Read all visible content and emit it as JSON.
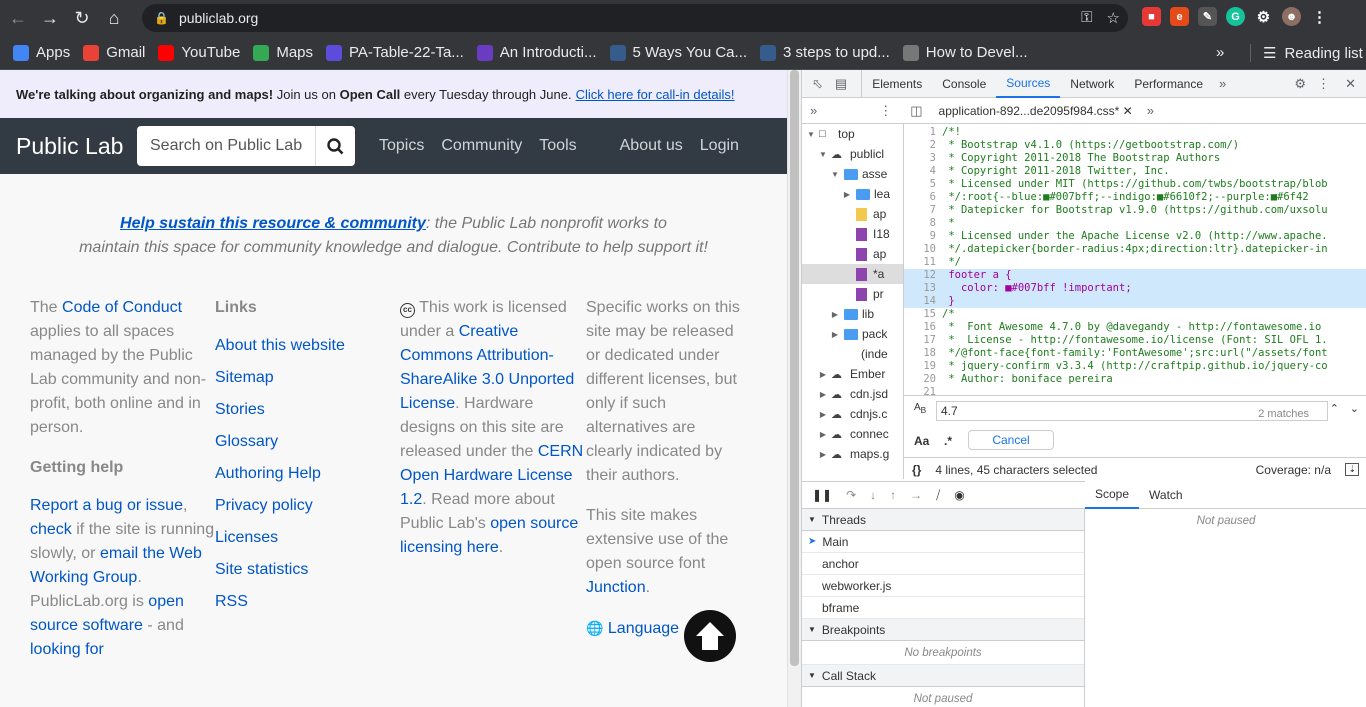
{
  "browser": {
    "url": "publiclab.org",
    "bookmarks": [
      {
        "label": "Apps",
        "icon": "apps-grid-icon",
        "color": "#4285f4"
      },
      {
        "label": "Gmail",
        "icon": "gmail-icon",
        "color": "#ea4335"
      },
      {
        "label": "YouTube",
        "icon": "youtube-icon",
        "color": "#ff0000"
      },
      {
        "label": "Maps",
        "icon": "maps-icon",
        "color": "#34a853"
      },
      {
        "label": "PA-Table-22-Ta...",
        "icon": "stack-icon",
        "color": "#5b4cdb"
      },
      {
        "label": "An Introducti...",
        "icon": "hexagon-icon",
        "color": "#6a3cc2"
      },
      {
        "label": "5 Ways You Ca...",
        "icon": "tds-icon",
        "color": "#355c8b"
      },
      {
        "label": "3 steps to upd...",
        "icon": "tds-icon",
        "color": "#355c8b"
      },
      {
        "label": "How to Devel...",
        "icon": "image-icon",
        "color": "#777777"
      }
    ],
    "reading_list": "Reading list"
  },
  "page": {
    "banner": {
      "bold": "We're talking about organizing and maps!",
      "text1": " Join us on ",
      "bold2": "Open Call",
      "text2": " every Tuesday through June.",
      "link": "Click here for call-in details!"
    },
    "brand": "Public Lab",
    "search_placeholder": "Search on Public Lab",
    "nav": [
      "Topics",
      "Community",
      "Tools",
      "About us",
      "Login"
    ],
    "sustain": {
      "link": "Help sustain this resource & community",
      "text": ": the Public Lab nonprofit works to",
      "line2": "maintain this space for community knowledge and dialogue. Contribute to help support it!"
    },
    "col1": {
      "t1": "The ",
      "l1": "Code of Conduct",
      "t2": " applies to all spaces managed by the Public Lab community and non-profit, both online and in person.",
      "heading": "Getting help",
      "l2": "Report a bug or issue",
      "t3": ", ",
      "l3": "check",
      "t4": " if the site is running slowly, or ",
      "l4": "email the Web Working Group",
      "t5": ". PublicLab.org is ",
      "l5": "open source software",
      "t6": " - and ",
      "l6": "looking for"
    },
    "col2": {
      "heading": "Links",
      "links": [
        "About this website",
        "Sitemap",
        "Stories",
        "Glossary",
        "Authoring Help",
        "Privacy policy",
        "Licenses",
        "Site statistics",
        "RSS"
      ]
    },
    "col3": {
      "t1": " This work is licensed under a ",
      "l1": "Creative Commons Attribution-ShareAlike 3.0 Unported License",
      "t2": ". Hardware designs on this site are released under the ",
      "l2": "CERN Open Hardware License 1.2",
      "t3": ". Read more about Public Lab's ",
      "l3": "open source licensing here",
      "t4": "."
    },
    "col4": {
      "p1": "Specific works on this site may be released or dedicated under different licenses, but only if such alternatives are clearly indicated by their authors.",
      "p2a": "This site makes extensive use of the open source font ",
      "p2l": "Junction",
      "p2b": ".",
      "language": "Language"
    }
  },
  "devtools": {
    "tabs": [
      "Elements",
      "Console",
      "Sources",
      "Network",
      "Performance"
    ],
    "active_tab": "Sources",
    "file_tab": "application-892...de2095f984.css*",
    "tree": [
      {
        "label": "top",
        "type": "frame",
        "depth": 0,
        "open": true
      },
      {
        "label": "publicl",
        "type": "cloud",
        "depth": 1,
        "open": true
      },
      {
        "label": "asse",
        "type": "folder",
        "depth": 2,
        "open": true
      },
      {
        "label": "lea",
        "type": "folder",
        "depth": 3,
        "open": false
      },
      {
        "label": "ap",
        "type": "file-js",
        "depth": 3
      },
      {
        "label": "I18",
        "type": "file-css",
        "depth": 3
      },
      {
        "label": "ap",
        "type": "file-css",
        "depth": 3
      },
      {
        "label": "*a",
        "type": "file-css",
        "depth": 3,
        "selected": true
      },
      {
        "label": "pr",
        "type": "file-css",
        "depth": 3
      },
      {
        "label": "lib",
        "type": "folder",
        "depth": 2,
        "open": false
      },
      {
        "label": "pack",
        "type": "folder",
        "depth": 2,
        "open": false
      },
      {
        "label": "(inde",
        "type": "file-doc",
        "depth": 2
      },
      {
        "label": "Ember",
        "type": "cloud",
        "depth": 1,
        "open": false
      },
      {
        "label": "cdn.jsd",
        "type": "cloud",
        "depth": 1,
        "open": false
      },
      {
        "label": "cdnjs.c",
        "type": "cloud",
        "depth": 1,
        "open": false
      },
      {
        "label": "connec",
        "type": "cloud",
        "depth": 1,
        "open": false
      },
      {
        "label": "maps.g",
        "type": "cloud",
        "depth": 1,
        "open": false
      }
    ],
    "code": [
      "/*!",
      " * Bootstrap v4.1.0 (https://getbootstrap.com/)",
      " * Copyright 2011-2018 The Bootstrap Authors",
      " * Copyright 2011-2018 Twitter, Inc.",
      " * Licensed under MIT (https://github.com/twbs/bootstrap/blob",
      " */:root{--blue:■#007bff;--indigo:■#6610f2;--purple:■#6f42",
      " * Datepicker for Bootstrap v1.9.0 (https://github.com/uxsolu",
      " *",
      " * Licensed under the Apache License v2.0 (http://www.apache.",
      " */.datepicker{border-radius:4px;direction:ltr}.datepicker-in",
      " */",
      " footer a {",
      "   color: ■#007bff !important;",
      " }",
      "/*",
      " *  Font Awesome 4.7.0 by @davegandy - http://fontawesome.io",
      " *  License - http://fontawesome.io/license (Font: SIL OFL 1.",
      " */@font-face{font-family:'FontAwesome';src:url(\"/assets/font",
      " * jquery-confirm v3.3.4 (http://craftpip.github.io/jquery-co",
      " * Author: boniface pereira",
      ""
    ],
    "find_value": "4.7",
    "find_matches": "2 matches",
    "cancel": "Cancel",
    "status": "4 lines, 45 characters selected",
    "coverage": "Coverage: n/a",
    "threads_label": "Threads",
    "threads": [
      "Main",
      "anchor",
      "webworker.js",
      "bframe"
    ],
    "breakpoints_label": "Breakpoints",
    "no_breakpoints": "No breakpoints",
    "callstack_label": "Call Stack",
    "not_paused": "Not paused",
    "scope_tab": "Scope",
    "watch_tab": "Watch"
  }
}
